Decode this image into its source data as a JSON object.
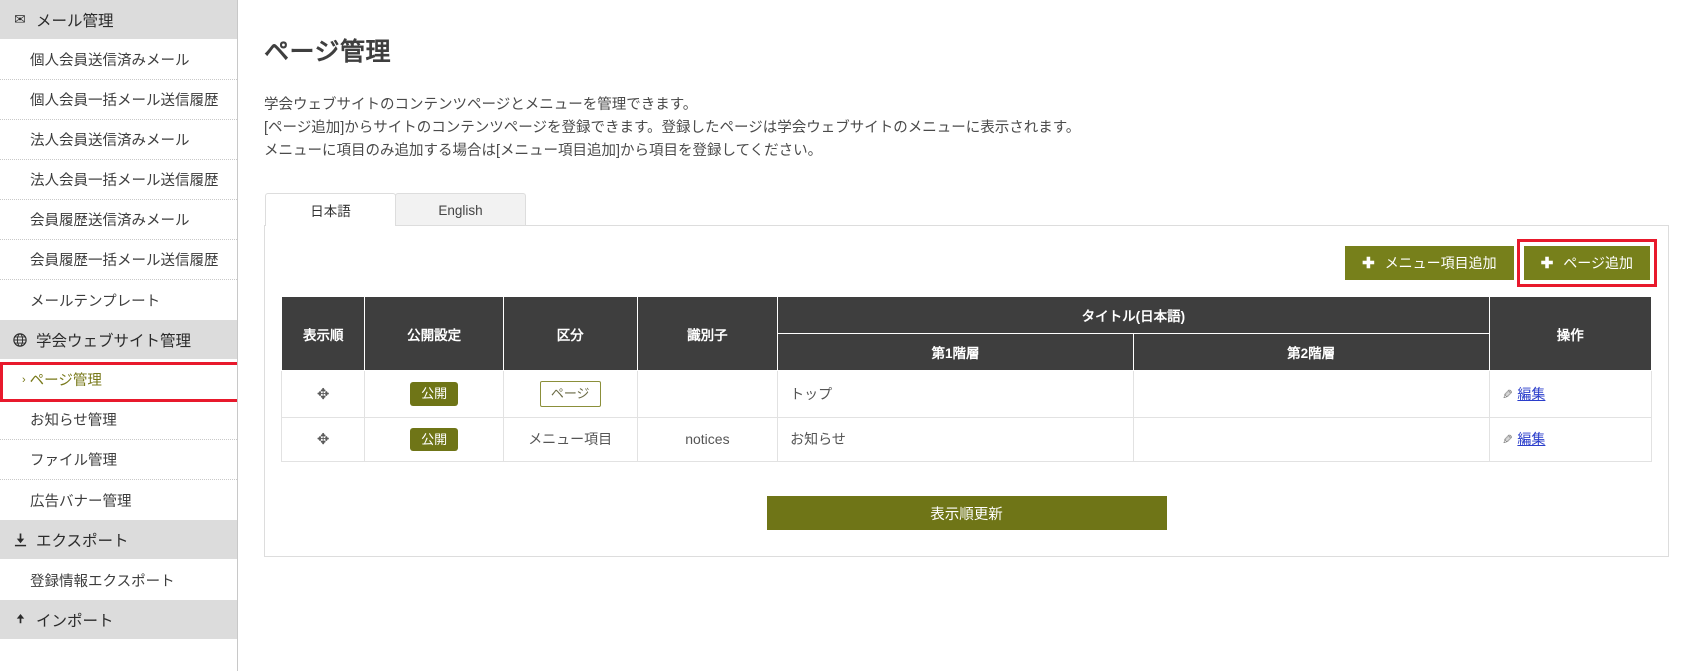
{
  "sidebar": {
    "groups": [
      {
        "label": "メール管理",
        "icon": "mail-icon",
        "glyph": "✉",
        "items": [
          {
            "label": "個人会員送信済みメール",
            "active": false
          },
          {
            "label": "個人会員一括メール送信履歴",
            "active": false
          },
          {
            "label": "法人会員送信済みメール",
            "active": false
          },
          {
            "label": "法人会員一括メール送信履歴",
            "active": false
          },
          {
            "label": "会員履歴送信済みメール",
            "active": false
          },
          {
            "label": "会員履歴一括メール送信履歴",
            "active": false
          },
          {
            "label": "メールテンプレート",
            "active": false
          }
        ]
      },
      {
        "label": "学会ウェブサイト管理",
        "icon": "globe-icon",
        "glyph": "🌐",
        "items": [
          {
            "label": "ページ管理",
            "active": true,
            "chevron": "›"
          },
          {
            "label": "お知らせ管理",
            "active": false
          },
          {
            "label": "ファイル管理",
            "active": false
          },
          {
            "label": "広告バナー管理",
            "active": false
          }
        ]
      },
      {
        "label": "エクスポート",
        "icon": "download-icon",
        "glyph": "⭳",
        "items": [
          {
            "label": "登録情報エクスポート",
            "active": false
          }
        ]
      },
      {
        "label": "インポート",
        "icon": "upload-icon",
        "glyph": "⬆",
        "items": []
      }
    ]
  },
  "main": {
    "page_title": "ページ管理",
    "description_lines": [
      "学会ウェブサイトのコンテンツページとメニューを管理できます。",
      "[ページ追加]からサイトのコンテンツページを登録できます。登録したページは学会ウェブサイトのメニューに表示されます。",
      "メニューに項目のみ追加する場合は[メニュー項目追加]から項目を登録してください。"
    ],
    "tabs": [
      {
        "label": "日本語",
        "active": true
      },
      {
        "label": "English",
        "active": false
      }
    ],
    "actions": {
      "add_menu_item": {
        "label": "メニュー項目追加",
        "plus": "✚"
      },
      "add_page": {
        "label": "ページ追加",
        "plus": "✚",
        "highlighted": true
      }
    },
    "table": {
      "headers": {
        "order": "表示順",
        "publish": "公開設定",
        "type": "区分",
        "identifier": "識別子",
        "title_group": "タイトル(日本語)",
        "level1": "第1階層",
        "level2": "第2階層",
        "operation": "操作"
      },
      "rows": [
        {
          "order_handle": "✥",
          "publish": "公開",
          "type": "ページ",
          "type_style": "boxed",
          "identifier": "",
          "level1": "トップ",
          "level2": "",
          "edit_label": "編集",
          "pencil": "✎"
        },
        {
          "order_handle": "✥",
          "publish": "公開",
          "type": "メニュー項目",
          "type_style": "plain",
          "identifier": "notices",
          "level1": "お知らせ",
          "level2": "",
          "edit_label": "編集",
          "pencil": "✎"
        }
      ]
    },
    "update_button": {
      "label": "表示順更新"
    }
  },
  "colors": {
    "accent_green": "#6f7517",
    "button_green": "#77801b",
    "highlight_red": "#e8192c",
    "table_header": "#3e3e3e",
    "link_blue": "#2b3ecb",
    "active_nav_text": "#78791a"
  }
}
